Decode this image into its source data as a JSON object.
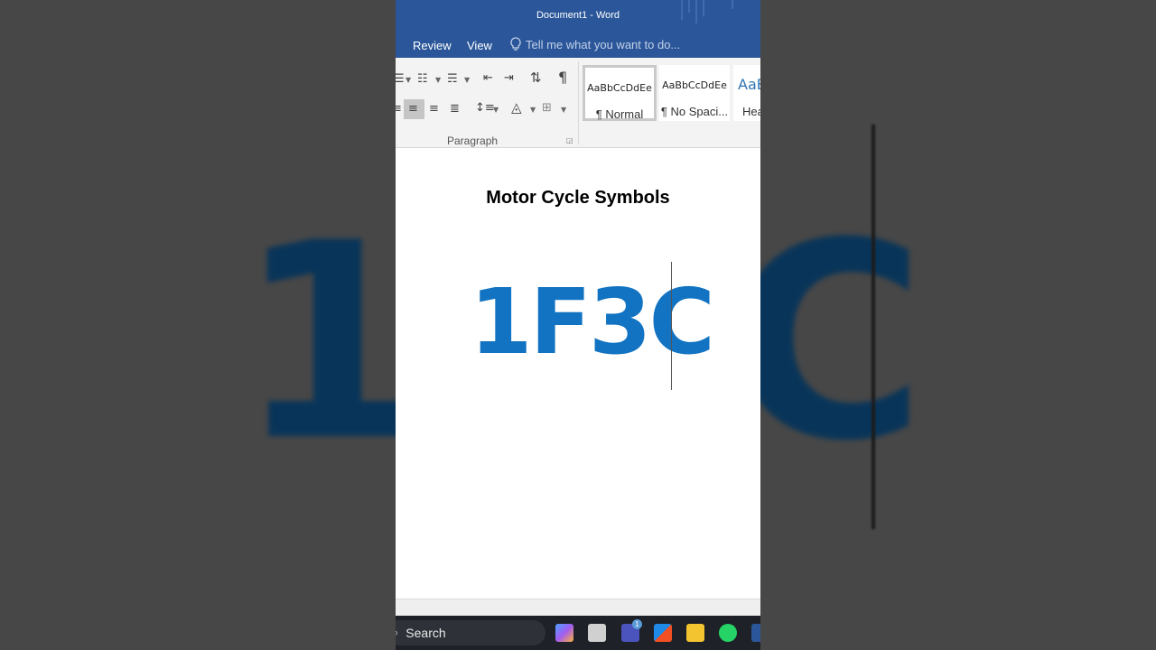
{
  "window": {
    "title": "Document1 - Word"
  },
  "menu": {
    "review": "Review",
    "view": "View",
    "tell_placeholder": "Tell me what you want to do..."
  },
  "ribbon": {
    "paragraph_group_label": "Paragraph",
    "styles": [
      {
        "sample": "AaBbCcDdEe",
        "name": "¶ Normal"
      },
      {
        "sample": "AaBbCcDdEe",
        "name": "¶ No Spaci..."
      },
      {
        "sample": "AaB",
        "name": "Hea"
      }
    ]
  },
  "document": {
    "heading": "Motor Cycle Symbols",
    "code_text": "1F3C"
  },
  "background_echo": {
    "left": "1",
    "right": "C"
  },
  "taskbar": {
    "search_label": "Search",
    "teams_badge": "1"
  },
  "colors": {
    "title_blue": "#2b579a",
    "code_blue": "#1173c1"
  }
}
